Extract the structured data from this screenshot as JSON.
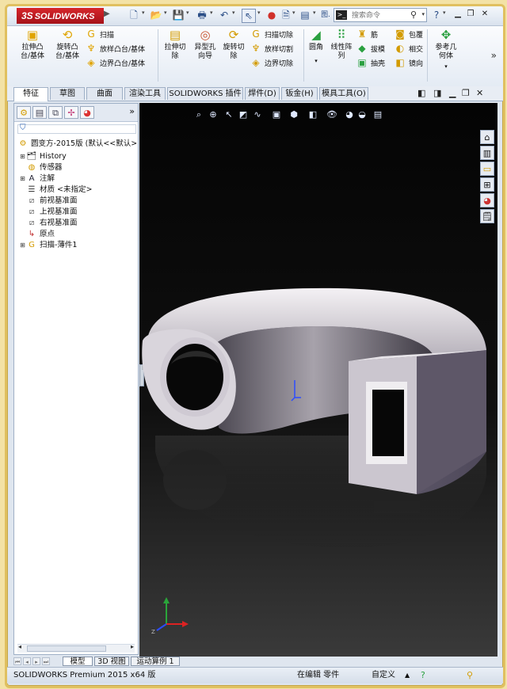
{
  "app": {
    "logo": "SOLIDWORKS",
    "logo_mark": "3S"
  },
  "search": {
    "placeholder": "搜索命令"
  },
  "command_manager": {
    "extrude_boss": "拉伸凸\n台/基体",
    "revolve_boss": "旋转凸\n台/基体",
    "sweep": "扫描",
    "loft_boss": "放样凸台/基体",
    "boundary_boss": "边界凸台/基体",
    "extrude_cut": "拉伸切\n除",
    "hole_wizard": "异型孔\n向导",
    "revolve_cut": "旋转切\n除",
    "swept_cut": "扫描切除",
    "lofted_cut": "放样切割",
    "boundary_cut": "边界切除",
    "fillet": "圆角",
    "linear_pattern": "线性阵\n列",
    "rib": "筋",
    "draft": "拔模",
    "shell": "抽壳",
    "wrap": "包覆",
    "intersect": "相交",
    "mirror": "镜向",
    "reference_geometry": "参考几\n何体"
  },
  "tabs": [
    "特征",
    "草图",
    "曲面",
    "渲染工具",
    "SOLIDWORKS 插件",
    "焊件(D)",
    "钣金(H)",
    "模具工具(O)"
  ],
  "tree": {
    "part": "圆变方-2015版 (默认<<默认>",
    "items": [
      {
        "label": "History",
        "icon": "history-icon"
      },
      {
        "label": "传感器",
        "icon": "sensor-icon"
      },
      {
        "label": "注解",
        "icon": "annotation-icon"
      },
      {
        "label": "材质 <未指定>",
        "icon": "material-icon"
      },
      {
        "label": "前视基准面",
        "icon": "plane-icon"
      },
      {
        "label": "上视基准面",
        "icon": "plane-icon"
      },
      {
        "label": "右视基准面",
        "icon": "plane-icon"
      },
      {
        "label": "原点",
        "icon": "origin-icon"
      },
      {
        "label": "扫描-薄件1",
        "icon": "sweep-feature-icon"
      }
    ]
  },
  "sheet_tabs": [
    "模型",
    "3D 视图",
    "运动算例 1"
  ],
  "status": {
    "product": "SOLIDWORKS Premium 2015 x64 版",
    "mode": "在编辑 零件",
    "units": "自定义",
    "arrow": "▲"
  },
  "colors": {
    "logo_red": "#c41e24",
    "frame_gold": "#e0c060",
    "viewport_bg": "#0b0b0b"
  }
}
